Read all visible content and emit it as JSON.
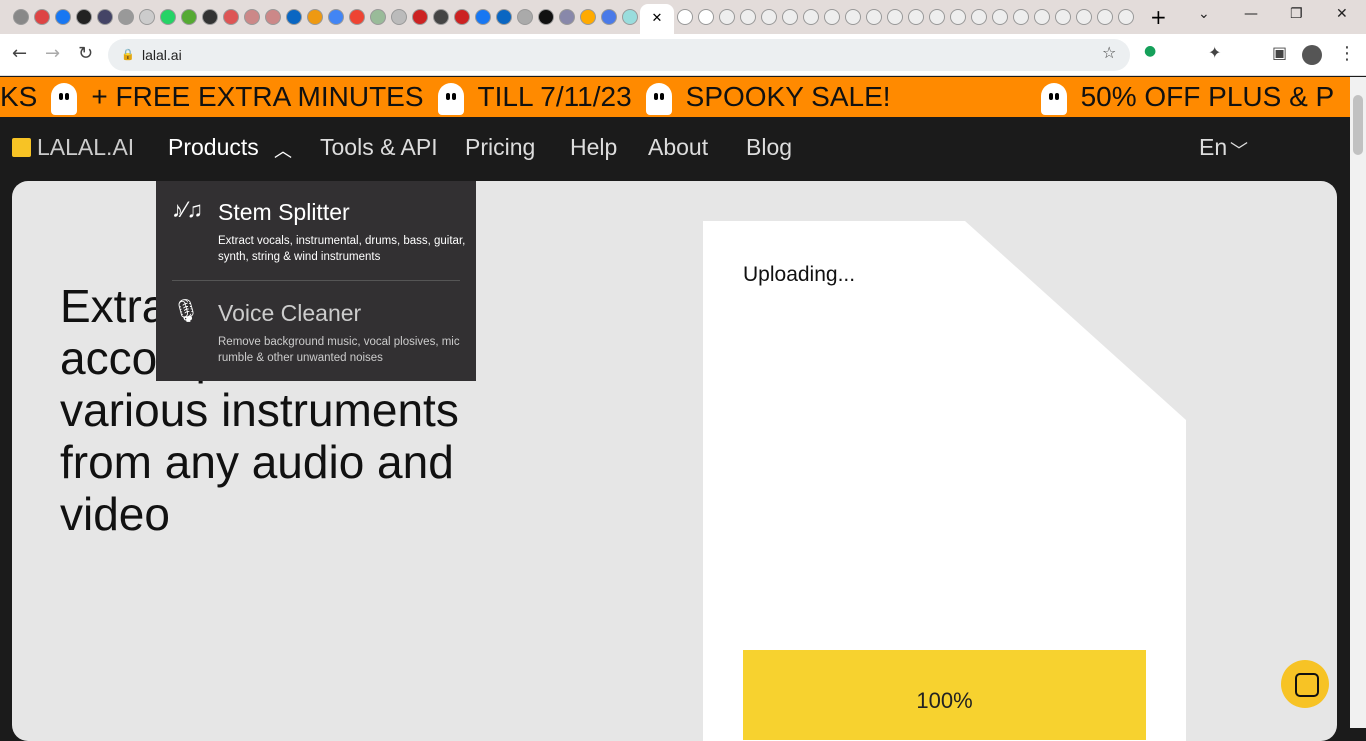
{
  "browser": {
    "tab_icons": [
      "chrome",
      "gmail",
      "facebook",
      "music",
      "app",
      "app",
      "app",
      "whatsapp",
      "asda",
      "text",
      "app",
      "app",
      "app",
      "linkedin",
      "slack",
      "google",
      "maps",
      "idr",
      "docs",
      "g",
      "si",
      "g",
      "facebook",
      "linkedin",
      "app",
      "app",
      "app",
      "drive",
      "docs",
      "app"
    ],
    "active_tab_close": "✕",
    "url": "lalal.ai",
    "new_tab": "+"
  },
  "banner": {
    "items": [
      "KS",
      "+ FREE EXTRA MINUTES",
      "TILL 7/11/23",
      "SPOOKY SALE!",
      "50% OFF PLUS & P"
    ]
  },
  "nav": {
    "logo": "LALAL.AI",
    "items": [
      "Products",
      "Tools & API",
      "Pricing",
      "Help",
      "About",
      "Blog"
    ],
    "language": "En"
  },
  "menu": {
    "items": [
      {
        "title": "Stem Splitter",
        "desc": "Extract vocals, instrumental, drums, bass, guitar, synth, string & wind instruments"
      },
      {
        "title": "Voice Cleaner",
        "desc": "Remove background music, vocal plosives, mic rumble & other unwanted noises"
      }
    ]
  },
  "hero": {
    "headline": "Extract vocals, accompaniment and various instruments from any audio and video"
  },
  "upload": {
    "status": "Uploading...",
    "progress_label": "100%",
    "progress": 1.0
  },
  "colors": {
    "banner": "#ff8a00",
    "accent": "#f7c325",
    "progress": "#f7d22f"
  }
}
